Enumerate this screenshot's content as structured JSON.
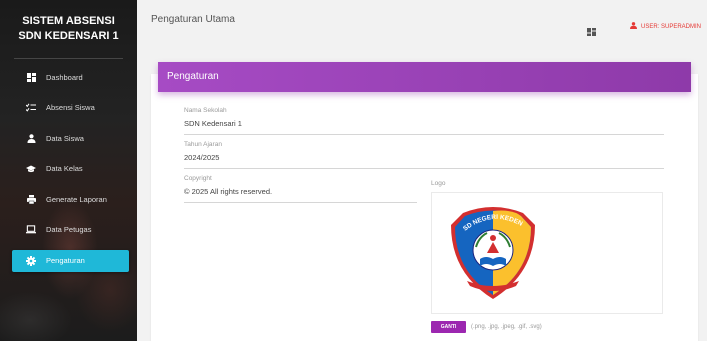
{
  "sidebar": {
    "brand_line1": "SISTEM ABSENSI",
    "brand_line2": "SDN KEDENSARI 1",
    "items": [
      {
        "label": "Dashboard",
        "icon": "dashboard-icon"
      },
      {
        "label": "Absensi Siswa",
        "icon": "checklist-icon"
      },
      {
        "label": "Data Siswa",
        "icon": "person-icon"
      },
      {
        "label": "Data Kelas",
        "icon": "graduation-cap-icon"
      },
      {
        "label": "Generate Laporan",
        "icon": "print-icon"
      },
      {
        "label": "Data Petugas",
        "icon": "laptop-icon"
      },
      {
        "label": "Pengaturan",
        "icon": "gear-icon",
        "active": true
      }
    ],
    "active_color": "#1fb8d8"
  },
  "header": {
    "title": "Pengaturan Utama",
    "user_label": "USER: SUPERADMIN",
    "user_color": "#e53935"
  },
  "card": {
    "title": "Pengaturan",
    "header_color": "#9c3fbd",
    "school_name": {
      "label": "Nama Sekolah",
      "value": "SDN Kedensari 1"
    },
    "school_year": {
      "label": "Tahun Ajaran",
      "value": "2024/2025"
    },
    "copyright": {
      "label": "Copyright",
      "value": "© 2025 All rights reserved."
    },
    "logo": {
      "label": "Logo",
      "badge_text": "SD NEGERI KEDENSARI 1"
    },
    "change_button": "GANTI",
    "file_hint": "(.png, .jpg, .jpeg, .gif, .svg)"
  }
}
